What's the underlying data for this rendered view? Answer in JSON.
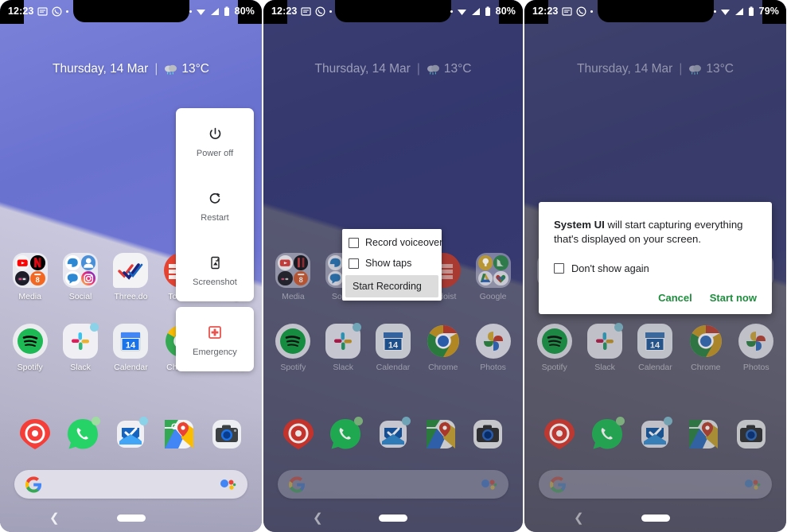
{
  "status_bar": {
    "time": "12:23",
    "battery_p1": "80%",
    "battery_p2": "80%",
    "battery_p3": "79%",
    "icons": [
      "message-icon",
      "whatsapp-icon",
      "dot-icon",
      "wifi-icon",
      "signal-icon",
      "battery-icon"
    ]
  },
  "home": {
    "date": "Thursday, 14 Mar",
    "separator": "|",
    "temperature": "13°C",
    "weather_icon": "rain-cloud-icon"
  },
  "app_grid": {
    "row1": [
      {
        "label": "Media",
        "icon": "media-folder-icon"
      },
      {
        "label": "Social",
        "icon": "social-folder-icon"
      },
      {
        "label": "Three.do",
        "icon": "threedo-icon"
      },
      {
        "label": "Todoist",
        "icon": "todoist-icon"
      },
      {
        "label": "Google",
        "icon": "google-folder-icon"
      }
    ],
    "row2": [
      {
        "label": "Spotify",
        "icon": "spotify-icon"
      },
      {
        "label": "Slack",
        "icon": "slack-icon"
      },
      {
        "label": "Calendar",
        "icon": "calendar-icon",
        "day": "14"
      },
      {
        "label": "Chrome",
        "icon": "chrome-icon"
      },
      {
        "label": "Photos",
        "icon": "google-photos-icon"
      }
    ]
  },
  "dock": [
    {
      "label": "Pocket Casts",
      "icon": "pocket-casts-icon"
    },
    {
      "label": "WhatsApp",
      "icon": "whatsapp-icon"
    },
    {
      "label": "Inbox",
      "icon": "inbox-icon"
    },
    {
      "label": "Maps",
      "icon": "google-maps-icon"
    },
    {
      "label": "Camera",
      "icon": "camera-icon"
    }
  ],
  "search_bar": {
    "logo": "google-g-icon",
    "assistant": "google-assistant-icon",
    "placeholder": ""
  },
  "nav_bar": {
    "back": "back-chevron-icon",
    "home": "home-pill-icon"
  },
  "power_menu": {
    "items": [
      {
        "label": "Power off",
        "icon": "power-icon"
      },
      {
        "label": "Restart",
        "icon": "restart-icon"
      },
      {
        "label": "Screenshot",
        "icon": "screenshot-icon"
      }
    ],
    "emergency": {
      "label": "Emergency",
      "icon": "emergency-cross-icon"
    }
  },
  "record_menu": {
    "voiceover_label": "Record voiceover",
    "show_taps_label": "Show taps",
    "start_label": "Start Recording"
  },
  "system_dialog": {
    "app_name": "System UI",
    "body": " will start capturing everything that's displayed on your screen.",
    "dont_show_label": "Don't show again",
    "cancel_label": "Cancel",
    "start_label": "Start now",
    "accent_color": "#1e8e3e"
  }
}
